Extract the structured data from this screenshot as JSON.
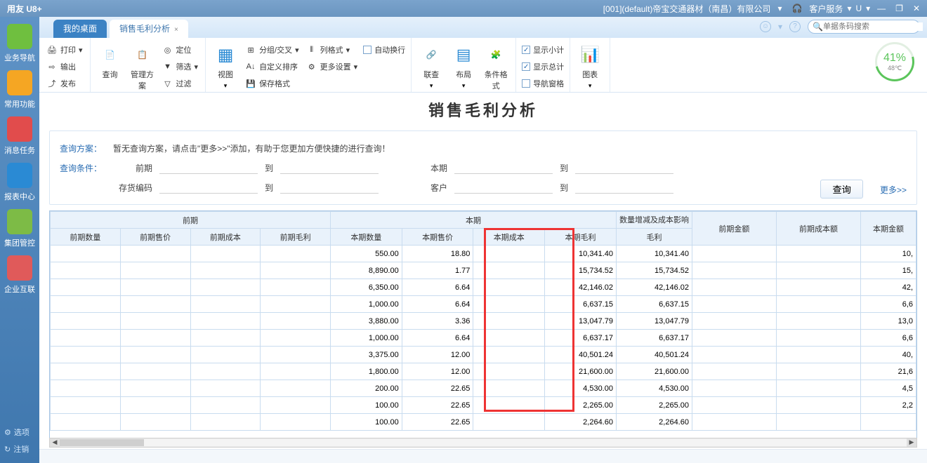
{
  "title_logo": "用友 U8+",
  "company": "[001](default)帝宝交通器材（南昌）有限公司",
  "top_service": "客户服务",
  "top_u": "U",
  "search_placeholder": "单据条码搜索",
  "sidebar": {
    "items": [
      {
        "label": "业务导航",
        "color": "#6fbf3f"
      },
      {
        "label": "常用功能",
        "color": "#f5a623"
      },
      {
        "label": "消息任务",
        "color": "#e14c4c"
      },
      {
        "label": "报表中心",
        "color": "#2a8ad4"
      },
      {
        "label": "集团管控",
        "color": "#7dbb46"
      },
      {
        "label": "企业互联",
        "color": "#e05a5a"
      }
    ],
    "option": "选项",
    "logout": "注销"
  },
  "tabs": {
    "desktop": "我的桌面",
    "active": "销售毛利分析"
  },
  "ribbon": {
    "g1": {
      "print": "打印",
      "output": "输出",
      "publish": "发布"
    },
    "g2": {
      "query": "查询",
      "plan": "管理方案",
      "locate": "定位",
      "filter": "筛选",
      "filter2": "过滤"
    },
    "g3": {
      "view": "视图",
      "groupcross": "分组/交叉",
      "customsort": "自定义排序",
      "saveformat": "保存格式",
      "colformat": "列格式",
      "moreset": "更多设置",
      "autowrap": "自动换行"
    },
    "g4": {
      "link": "联查",
      "layout": "布局",
      "condformat": "条件格式"
    },
    "g5": {
      "subtotal": "显示小计",
      "total": "显示总计",
      "navpane": "导航窗格"
    },
    "g6": {
      "chart": "图表"
    },
    "perf": {
      "pct": "41%",
      "temp": "48℃"
    }
  },
  "report_title": "销售毛利分析",
  "filter": {
    "plan_label": "查询方案：",
    "plan_hint": "暂无查询方案，请点击\"更多>>\"添加，有助于您更加方便快捷的进行查询！",
    "cond_label": "查询条件：",
    "prev": "前期",
    "to": "到",
    "stockcode": "存货编码",
    "current": "本期",
    "customer": "客户",
    "query_btn": "查询",
    "more": "更多>>"
  },
  "table": {
    "group_prev": "前期",
    "group_cur": "本期",
    "group_chg": "数量增减及成本影响",
    "col_prev_qty": "前期数量",
    "col_prev_price": "前期售价",
    "col_prev_cost": "前期成本",
    "col_prev_profit": "前期毛利",
    "col_cur_qty": "本期数量",
    "col_cur_price": "本期售价",
    "col_cur_cost": "本期成本",
    "col_cur_profit": "本期毛利",
    "col_chg_profit": "毛利",
    "col_prev_amt": "前期金额",
    "col_prev_cost_amt": "前期成本额",
    "col_cur_amt": "本期金额",
    "rows": [
      {
        "cur_qty": "550.00",
        "cur_price": "18.80",
        "cur_profit": "10,341.40",
        "chg_profit": "10,341.40",
        "cur_amt": "10,"
      },
      {
        "cur_qty": "8,890.00",
        "cur_price": "1.77",
        "cur_profit": "15,734.52",
        "chg_profit": "15,734.52",
        "cur_amt": "15,"
      },
      {
        "cur_qty": "6,350.00",
        "cur_price": "6.64",
        "cur_profit": "42,146.02",
        "chg_profit": "42,146.02",
        "cur_amt": "42,"
      },
      {
        "cur_qty": "1,000.00",
        "cur_price": "6.64",
        "cur_profit": "6,637.15",
        "chg_profit": "6,637.15",
        "cur_amt": "6,6"
      },
      {
        "cur_qty": "3,880.00",
        "cur_price": "3.36",
        "cur_profit": "13,047.79",
        "chg_profit": "13,047.79",
        "cur_amt": "13,0"
      },
      {
        "cur_qty": "1,000.00",
        "cur_price": "6.64",
        "cur_profit": "6,637.17",
        "chg_profit": "6,637.17",
        "cur_amt": "6,6"
      },
      {
        "cur_qty": "3,375.00",
        "cur_price": "12.00",
        "cur_profit": "40,501.24",
        "chg_profit": "40,501.24",
        "cur_amt": "40,"
      },
      {
        "cur_qty": "1,800.00",
        "cur_price": "12.00",
        "cur_profit": "21,600.00",
        "chg_profit": "21,600.00",
        "cur_amt": "21,6"
      },
      {
        "cur_qty": "200.00",
        "cur_price": "22.65",
        "cur_profit": "4,530.00",
        "chg_profit": "4,530.00",
        "cur_amt": "4,5"
      },
      {
        "cur_qty": "100.00",
        "cur_price": "22.65",
        "cur_profit": "2,265.00",
        "chg_profit": "2,265.00",
        "cur_amt": "2,2"
      },
      {
        "cur_qty": "100.00",
        "cur_price": "22.65",
        "cur_profit": "2,264.60",
        "chg_profit": "2,264.60",
        "cur_amt": ""
      }
    ]
  }
}
